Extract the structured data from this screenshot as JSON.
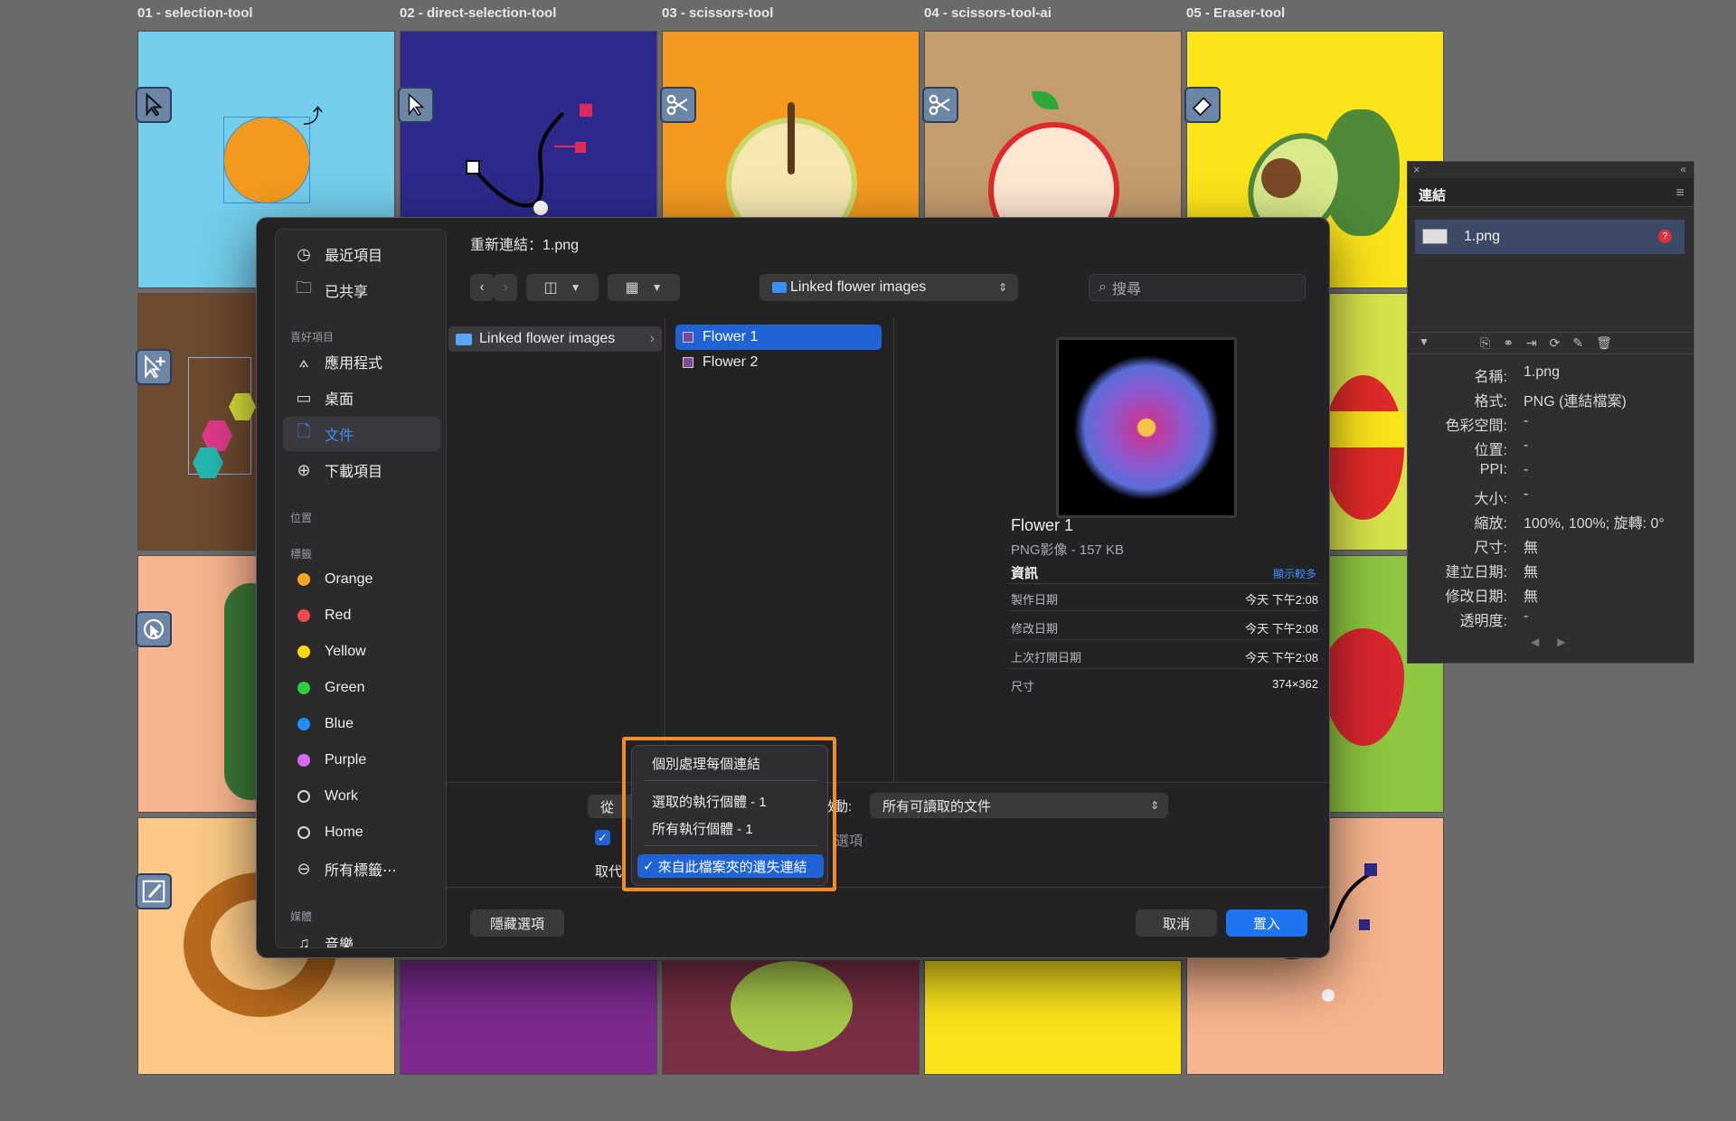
{
  "artboards": {
    "labels": [
      "01 - selection-tool",
      "02 - direct-selection-tool",
      "03 - scissors-tool",
      "04 - scissors-tool-ai",
      "05 - Eraser-tool"
    ],
    "colors": {
      "sky": "#74cdeb",
      "navy": "#2d2a8c",
      "orange": "#f39a1e",
      "tan": "#c49c6e",
      "yellow": "#fce41a",
      "brown": "#6e4a30",
      "peach": "#f7b48e",
      "lime": "#8dc63f",
      "cream": "#fbc985",
      "purple": "#7c2a8e",
      "maroon": "#7a2f45"
    }
  },
  "dialog": {
    "title": "重新連結：1.png",
    "location": "Linked flower images",
    "search_placeholder": "搜尋",
    "sidebar": {
      "recent": "最近項目",
      "shared": "已共享",
      "favorites_header": "喜好項目",
      "applications": "應用程式",
      "desktop": "桌面",
      "documents": "文件",
      "downloads": "下載項目",
      "locations_header": "位置",
      "tags_header": "標籤",
      "tags": [
        {
          "label": "Orange",
          "color": "#f5a623"
        },
        {
          "label": "Red",
          "color": "#f04b4b"
        },
        {
          "label": "Yellow",
          "color": "#f5d90a"
        },
        {
          "label": "Green",
          "color": "#2ecc40"
        },
        {
          "label": "Blue",
          "color": "#1e90ff"
        },
        {
          "label": "Purple",
          "color": "#d66bf2"
        },
        {
          "label": "Work",
          "color": ""
        },
        {
          "label": "Home",
          "color": ""
        }
      ],
      "all_tags": "所有標籤⋯",
      "media_header": "媒體",
      "music": "音樂"
    },
    "folder_column": [
      "Linked flower images"
    ],
    "file_column": [
      "Flower 1",
      "Flower 2"
    ],
    "preview": {
      "name": "Flower 1",
      "kind": "PNG影像 - 157 KB",
      "info_header": "資訊",
      "show_more": "顯示較多",
      "rows": [
        {
          "k": "製作日期",
          "v": "今天 下午2:08"
        },
        {
          "k": "修改日期",
          "v": "今天 下午2:08"
        },
        {
          "k": "上次打開日期",
          "v": "今天 下午2:08"
        },
        {
          "k": "尺寸",
          "v": "374×362"
        }
      ]
    },
    "options": {
      "from_label": "從",
      "enable_label": "啟動:",
      "enable_value": "所有可讀取的文件",
      "options_label": "選項",
      "replace_label": "取代"
    },
    "popup": {
      "items": [
        "個別處理每個連結",
        "選取的執行個體 - 1",
        "所有執行個體 - 1",
        "來自此檔案夾的遺失連結"
      ],
      "checked_index": 3,
      "check_mark": "✓"
    },
    "buttons": {
      "hide_options": "隱藏選項",
      "cancel": "取消",
      "place": "置入"
    }
  },
  "links_panel": {
    "title": "連結",
    "file": "1.png",
    "props": [
      {
        "k": "名稱:",
        "v": "1.png"
      },
      {
        "k": "格式:",
        "v": "PNG (連結檔案)"
      },
      {
        "k": "色彩空間:",
        "v": "-"
      },
      {
        "k": "位置:",
        "v": "-"
      },
      {
        "k": "PPI:",
        "v": "-"
      },
      {
        "k": "大小:",
        "v": "-"
      },
      {
        "k": "縮放:",
        "v": "100%, 100%; 旋轉: 0°"
      },
      {
        "k": "尺寸:",
        "v": "無"
      },
      {
        "k": "建立日期:",
        "v": "無"
      },
      {
        "k": "修改日期:",
        "v": "無"
      },
      {
        "k": "透明度:",
        "v": "-"
      }
    ]
  }
}
